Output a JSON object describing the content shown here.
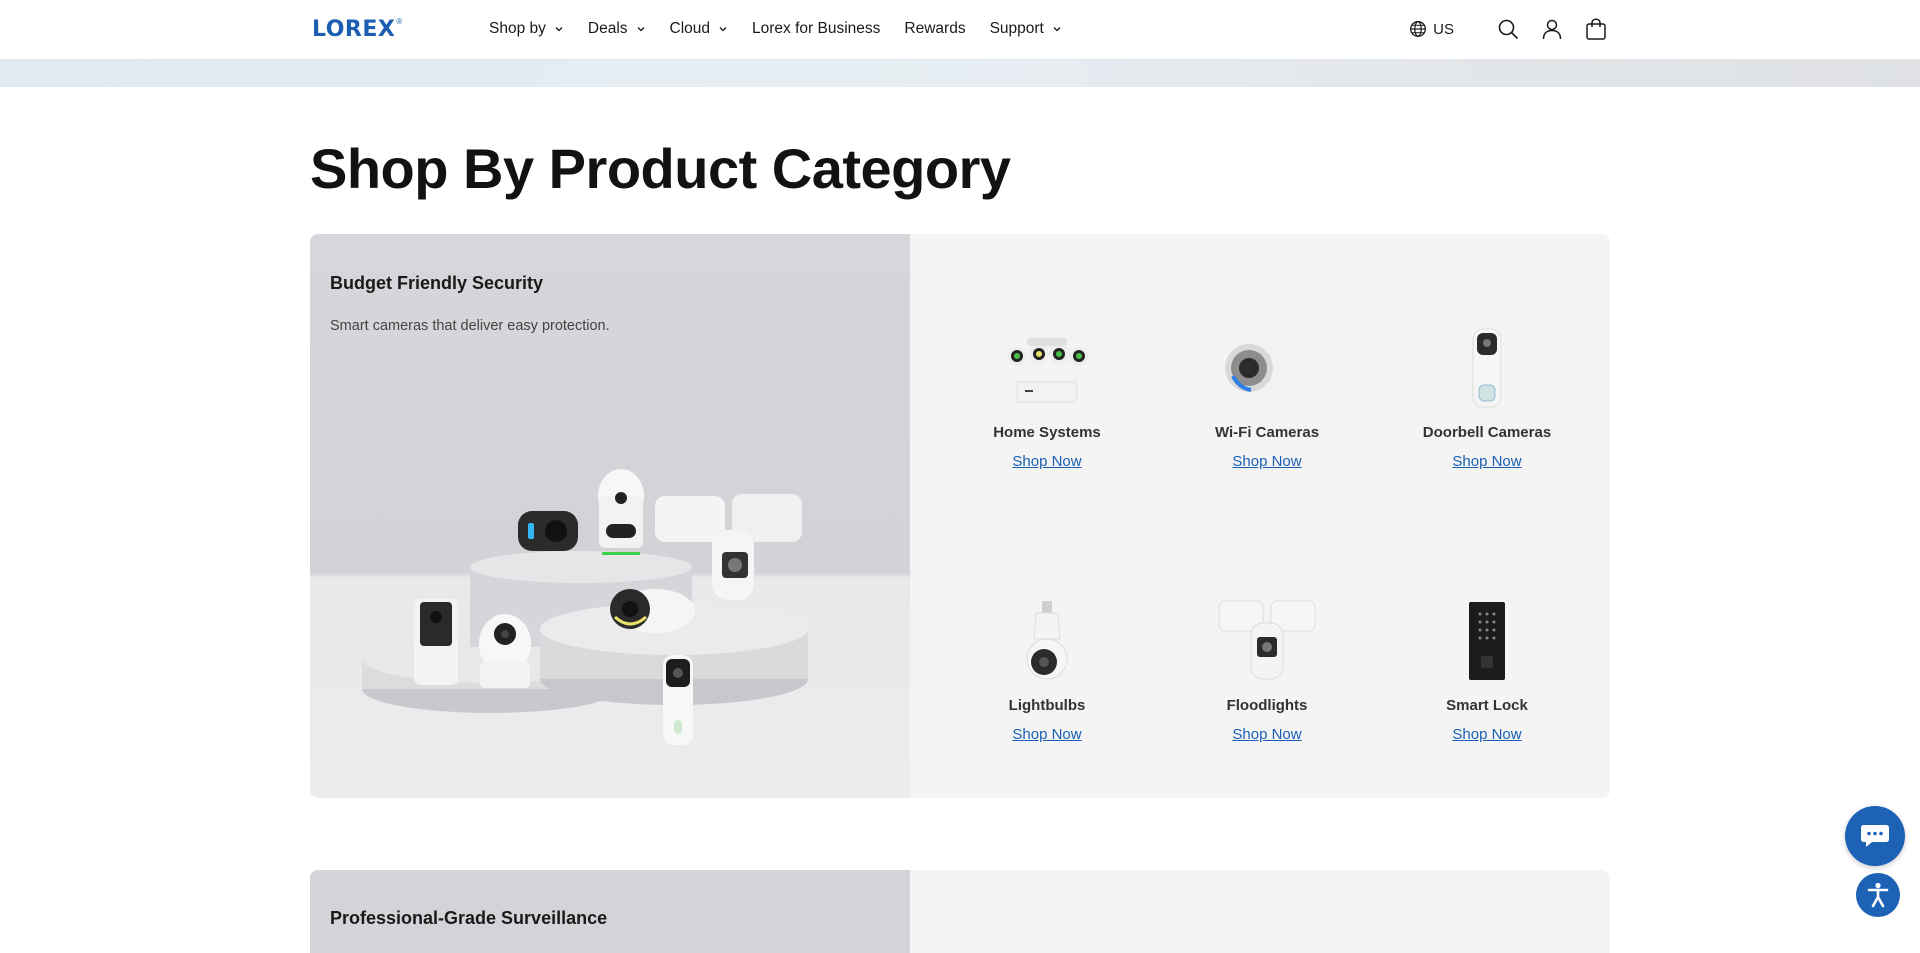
{
  "header": {
    "logo": "LOREX",
    "nav": [
      {
        "label": "Shop by",
        "dropdown": true
      },
      {
        "label": "Deals",
        "dropdown": true
      },
      {
        "label": "Cloud",
        "dropdown": true
      },
      {
        "label": "Lorex for Business",
        "dropdown": false
      },
      {
        "label": "Rewards",
        "dropdown": false
      },
      {
        "label": "Support",
        "dropdown": true
      }
    ],
    "locale": "US",
    "icons": [
      "globe-icon",
      "search-icon",
      "account-icon",
      "cart-icon"
    ]
  },
  "main": {
    "title": "Shop By Product Category",
    "card": {
      "heading": "Budget Friendly Security",
      "subtitle": "Smart cameras that deliver easy protection.",
      "products": [
        {
          "name": "Home Systems",
          "link": "Shop Now"
        },
        {
          "name": "Wi-Fi Cameras",
          "link": "Shop Now"
        },
        {
          "name": "Doorbell Cameras",
          "link": "Shop Now"
        },
        {
          "name": "Lightbulbs",
          "link": "Shop Now"
        },
        {
          "name": "Floodlights",
          "link": "Shop Now"
        },
        {
          "name": "Smart Lock",
          "link": "Shop Now"
        }
      ]
    },
    "card2": {
      "heading": "Professional-Grade Surveillance"
    }
  },
  "colors": {
    "brand": "#1c5fb0",
    "link": "#1a5fb4",
    "fab": "#1e62b6"
  }
}
